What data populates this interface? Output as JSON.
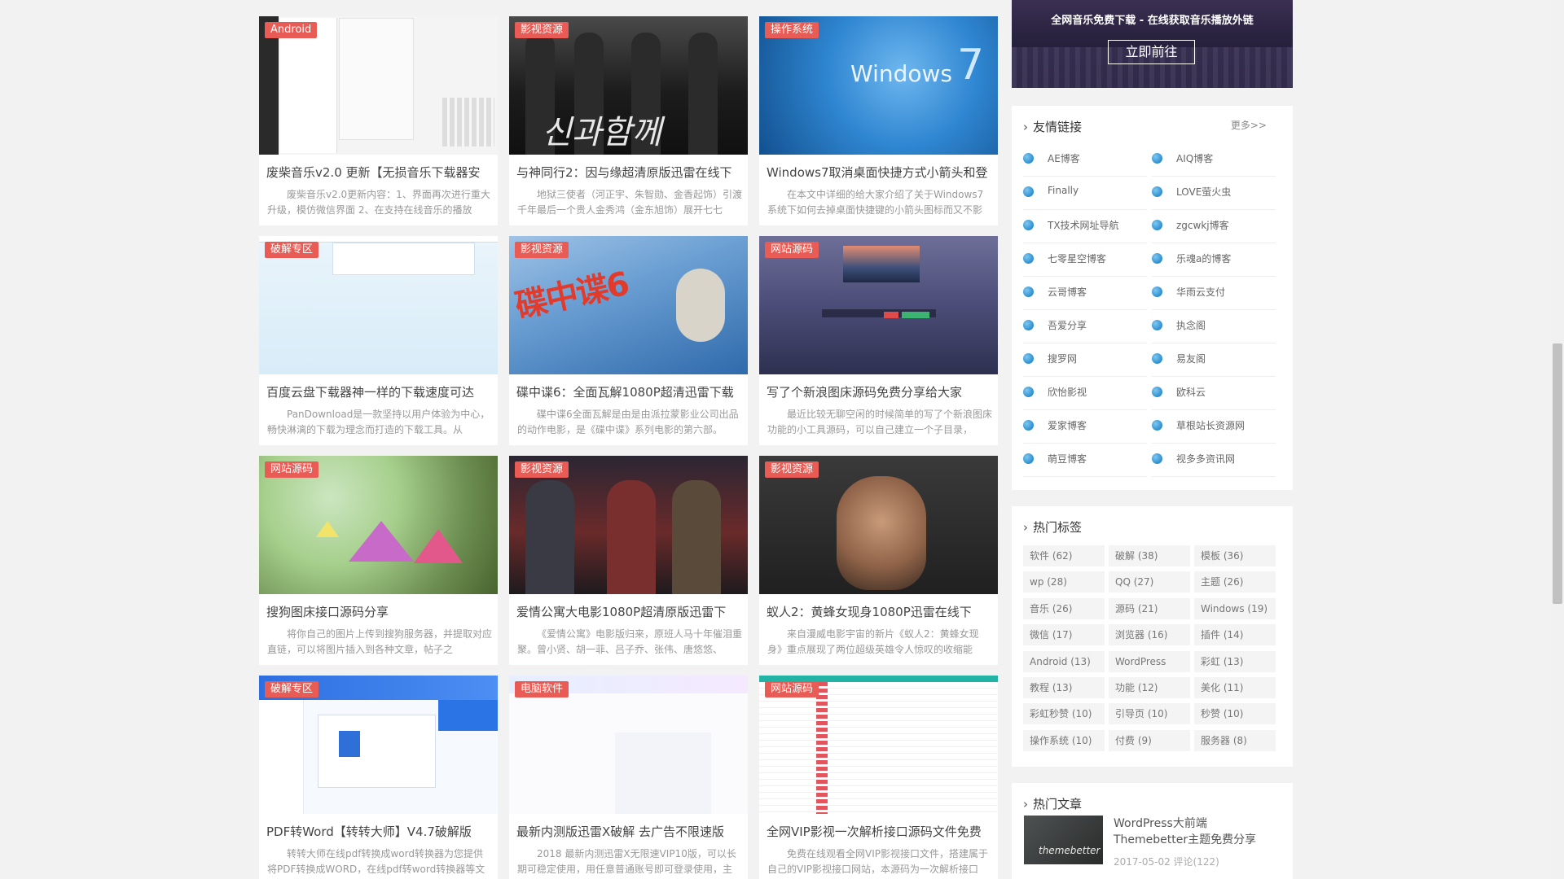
{
  "posts": [
    {
      "badge": "Android",
      "title": "废柴音乐v2.0 更新【无损音乐下载器安",
      "excerpt": "废柴音乐v2.0更新内容：1、界面再次进行重大升级，模仿微信界面 2、在支持在线音乐的播放"
    },
    {
      "badge": "影视资源",
      "title": "与神同行2：因与缘超清原版迅雷在线下",
      "excerpt": "地狱三使者（河正宇、朱智勋、金香起饰）引渡千年最后一个贵人金秀鸿（金东旭饰）展开七七"
    },
    {
      "badge": "操作系统",
      "title": "Windows7取消桌面快捷方式小箭头和登",
      "excerpt": "在本文中详细的给大家介绍了关于Windows7系统下如何去掉桌面快捷键的小箭头图标而又不影"
    },
    {
      "badge": "破解专区",
      "title": "百度云盘下载器神一样的下载速度可达",
      "excerpt": "PanDownload是一款坚持以用户体验为中心，畅快淋漓的下载为理念而打造的下载工具。从"
    },
    {
      "badge": "影视资源",
      "title": "碟中谍6：全面瓦解1080P超清迅雷下载",
      "excerpt": "碟中谍6全面瓦解是由是由派拉蒙影业公司出品的动作电影，是《碟中谍》系列电影的第六部。"
    },
    {
      "badge": "网站源码",
      "title": "写了个新浪图床源码免费分享给大家",
      "excerpt": "最近比较无聊空闲的时候简单的写了个新浪图床功能的小工具源码，可以自己建立一个子目录，"
    },
    {
      "badge": "网站源码",
      "title": "搜狗图床接口源码分享",
      "excerpt": "将你自己的图片上传到搜狗服务器，并提取对应直链，可以将图片插入到各种文章，帖子之"
    },
    {
      "badge": "影视资源",
      "title": "爱情公寓大电影1080P超清原版迅雷下",
      "excerpt": "《爱情公寓》电影版归来，原班人马十年催泪重聚。曾小贤、胡一菲、吕子乔、张伟、唐悠悠、"
    },
    {
      "badge": "影视资源",
      "title": "蚁人2：黄蜂女现身1080P迅雷在线下",
      "excerpt": "来自漫威电影宇宙的新片《蚁人2：黄蜂女现身》重点展现了两位超级英雄令人惊叹的收缩能"
    },
    {
      "badge": "破解专区",
      "title": "PDF转Word【转转大师】V4.7破解版",
      "excerpt": "转转大师在线pdf转换成word转换器为您提供将PDF转换成WORD，在线pdf转word转换器等文"
    },
    {
      "badge": "电脑软件",
      "title": "最新内测版迅雷X破解 去广告不限速版",
      "excerpt": "2018 最新内测迅雷X无限速VIP10版，可以长期可稳定使用，用任意普通账号即可登录使用，主"
    },
    {
      "badge": "网站源码",
      "title": "全网VIP影视一次解析接口源码文件免费",
      "excerpt": "免费在线观看全网VIP影视接口文件，搭建属于自己的VIP影视接口网站，本源码为一次解析接口"
    }
  ],
  "thumb_text": {
    "windows": "Windows",
    "windows_num": "7",
    "mi6": "碟中谍6",
    "film1": "신과함께",
    "hot_thumb": "themebetter"
  },
  "sidebar": {
    "banner": {
      "title": "全网音乐免费下载 - 在线获取音乐播放外链",
      "button": "立即前往"
    },
    "links": {
      "heading": "友情链接",
      "more": "更多>>",
      "items": [
        "AE博客",
        "AIQ博客",
        "Finally",
        "LOVE萤火虫",
        "TX技术网址导航",
        "zgcwkj博客",
        "七零星空博客",
        "乐魂a的博客",
        "云哥博客",
        "华雨云支付",
        "吾爱分享",
        "执念阁",
        "搜罗网",
        "易友阁",
        "欣怡影视",
        "欧科云",
        "爱家博客",
        "草根站长资源网",
        "萌豆博客",
        "视多多资讯网"
      ]
    },
    "tags": {
      "heading": "热门标签",
      "items": [
        "软件 (62)",
        "破解 (38)",
        "模板 (36)",
        "wp (28)",
        "QQ (27)",
        "主题 (26)",
        "音乐 (26)",
        "源码 (21)",
        "Windows (19)",
        "微信 (17)",
        "浏览器 (16)",
        "插件 (14)",
        "Android (13)",
        "WordPress",
        "彩虹 (13)",
        "教程 (13)",
        "功能 (12)",
        "美化 (11)",
        "彩虹秒赞 (10)",
        "引导页 (10)",
        "秒赞 (10)",
        "操作系统 (10)",
        "付费 (9)",
        "服务器 (8)"
      ]
    },
    "hot": {
      "heading": "热门文章",
      "title": "WordPress大前端Themebetter主题免费分享",
      "meta": "2017-05-02    评论(122)"
    }
  },
  "colors": {
    "badge": "#e85c55",
    "accent": "#2b8fd0",
    "background": "#f2f2f2"
  }
}
